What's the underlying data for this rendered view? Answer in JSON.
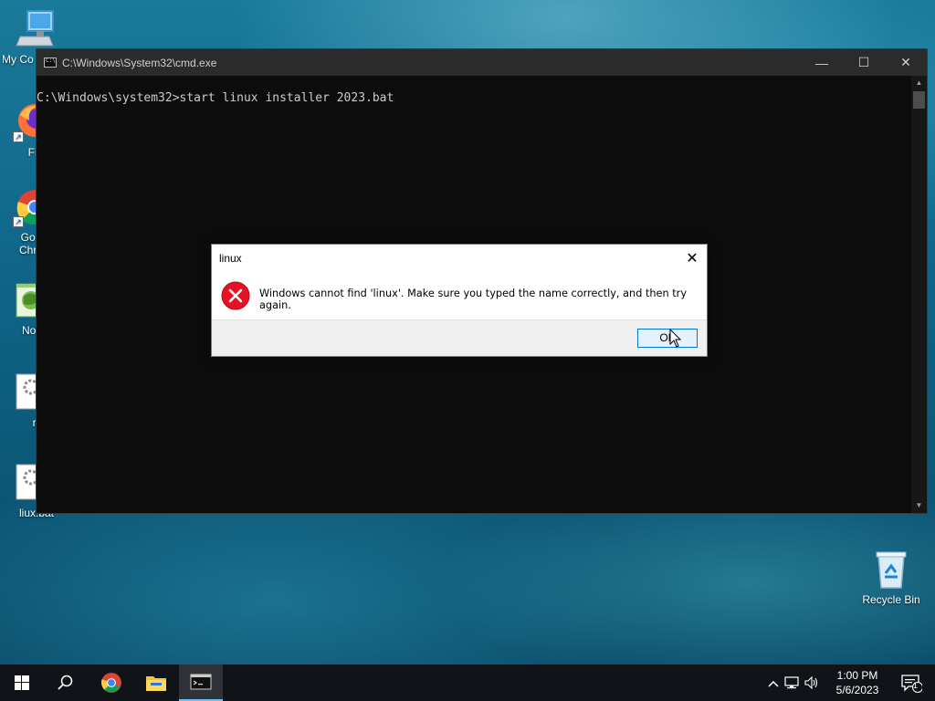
{
  "desktop": {
    "icons": [
      {
        "label": "My Co"
      },
      {
        "label": "Fire"
      },
      {
        "label": "Goo Chro"
      },
      {
        "label": "Notep"
      },
      {
        "label": "r.c"
      },
      {
        "label": "liux.bat"
      }
    ],
    "recycle_bin": {
      "label": "Recycle Bin"
    }
  },
  "cmd_window": {
    "title": "C:\\Windows\\System32\\cmd.exe",
    "controls": {
      "minimize": "—",
      "maximize": "☐",
      "close": "✕"
    },
    "console_line": "C:\\Windows\\system32>start linux installer 2023.bat"
  },
  "dialog": {
    "title": "linux",
    "message": "Windows cannot find 'linux'. Make sure you typed the name correctly, and then try again.",
    "ok_label": "OK",
    "close_glyph": "✕",
    "icon": "error-icon"
  },
  "taskbar": {
    "clock_time": "1:00 PM",
    "clock_date": "5/6/2023",
    "notification_count": "1",
    "tray_chevron": "^"
  },
  "colors": {
    "dialog_ok_border": "#0078d7",
    "error_red": "#e81123",
    "taskbar": "#101418"
  }
}
